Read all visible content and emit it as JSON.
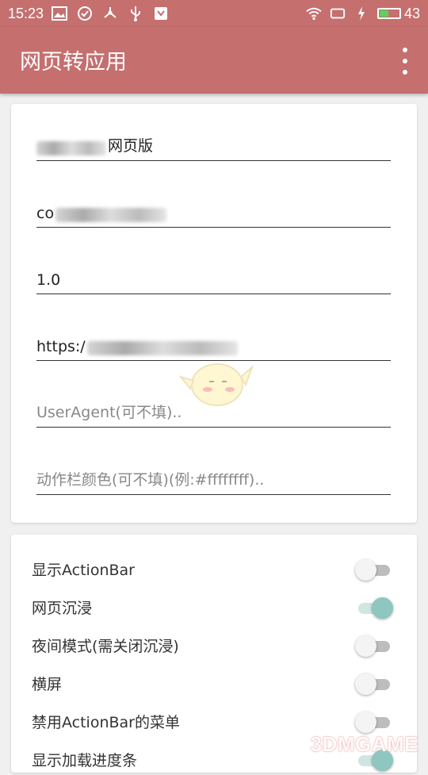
{
  "status_bar": {
    "time": "15:23",
    "battery_level": "43",
    "battery_fraction": 0.43,
    "icons_left": [
      "image-icon",
      "check-circle-icon",
      "usb-share-icon",
      "usb-icon",
      "shield-icon"
    ],
    "icons_right": [
      "wifi-icon",
      "screen-icon",
      "charging-icon",
      "battery-icon"
    ]
  },
  "app_bar": {
    "title": "网页转应用",
    "menu_icon": "more-vert-icon"
  },
  "form": {
    "app_name_value": "网页版",
    "package_value": "co",
    "version_value": "1.0",
    "url_value": "https:/",
    "user_agent_placeholder": "UserAgent(可不填)..",
    "actionbar_color_placeholder": "动作栏颜色(可不填)(例:#ffffffff).."
  },
  "settings": [
    {
      "label": "显示ActionBar",
      "on": false
    },
    {
      "label": "网页沉浸",
      "on": true
    },
    {
      "label": "夜间模式(需关闭沉浸)",
      "on": false
    },
    {
      "label": "横屏",
      "on": false
    },
    {
      "label": "禁用ActionBar的菜单",
      "on": false
    },
    {
      "label": "显示加载进度条",
      "on": true
    }
  ],
  "watermark": "3DMGAME",
  "colors": {
    "primary": "#c56f6f",
    "switch_on": "#8ec7bf",
    "background": "#f0f0f0"
  }
}
